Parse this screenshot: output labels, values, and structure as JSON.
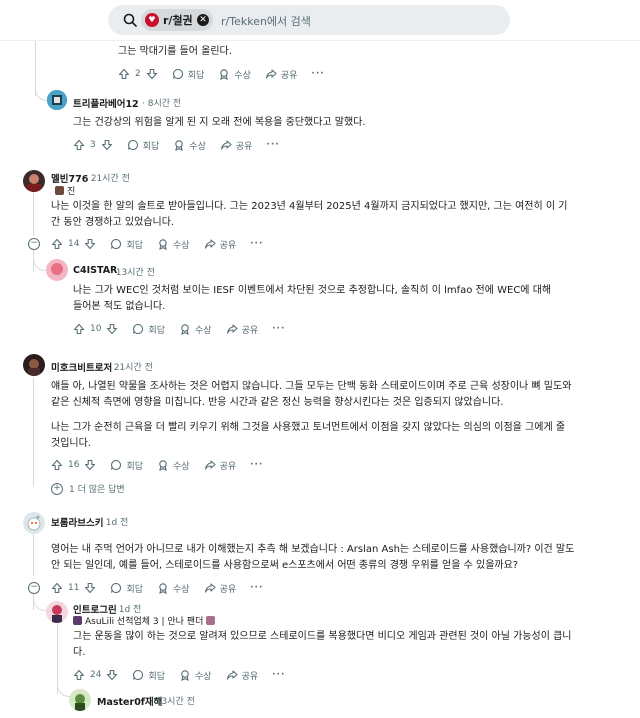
{
  "search": {
    "chip_label": "r/철권",
    "placeholder": "r/Tekken에서 검색"
  },
  "labels": {
    "reply": "회답",
    "award": "수상",
    "share": "공유",
    "more": "···",
    "more_replies": "1 더 많은 답변"
  },
  "comments": [
    {
      "text": "그는 막대기를 들어 올린다.",
      "votes": "2"
    },
    {
      "user": "트리플라베어12",
      "time": "8시간 전",
      "text": "그는 건강상의 위험을 알게 된 지 오래 전에 복용을 중단했다고 말했다.",
      "votes": "3"
    },
    {
      "user": "멜빈776",
      "time": "21시간 전",
      "flair": "진",
      "text": "나는 이것을 한 알의 솔트로 받아들입니다. 그는 2023년 4월부터 2025년 4월까지 금지되었다고 했지만, 그는 여전히 이 기간 동안 경쟁하고 있었습니다.",
      "votes": "14"
    },
    {
      "user": "C4ISTAR",
      "time": "13시간 전",
      "text": "나는 그가 WEC인 것처럼 보이는 IESF 이벤트에서 차단된 것으로 추정합니다, 솔직히 이 lmfao 전에 WEC에 대해 들어본 적도 없습니다.",
      "votes": "10"
    },
    {
      "user": "미호크비트로저",
      "time": "21시간 전",
      "text1": "얘들 아, 나열된 약물을 조사하는 것은 어렵지 않습니다. 그들 모두는 단백 동화 스테로이드이며 주로 근육 성장이나 뼈 밀도와 같은 신체적 측면에 영향을 미칩니다. 반응 시간과 같은 정신 능력을 향상시킨다는 것은 입증되지 않았습니다.",
      "text2": "나는 그가 순전히 근육을 더 빨리 키우기 위해 그것을 사용했고 토너먼트에서 이점을 갖지 않았다는 의심의 이점을 그에게 줄 것입니다.",
      "votes": "16"
    },
    {
      "user": "보롬라브스키",
      "time": "1d 전",
      "text": "영어는 내 주먹 언어가 아니므로 내가 이해했는지 추측 해 보겠습니다 : Arslan Ash는 스테로이드를 사용했습니까? 이건 말도 안 되는 일인데, 예를 들어, 스테로이드를 사용함으로써 e스포츠에서 어떤 종류의 경쟁 우위를 얻을 수 있을까요?",
      "votes": "11"
    },
    {
      "user": "인트로그린",
      "time": "1d 전",
      "flair": "AsuLili 선적업체 3 | 안나 팬더",
      "text": "그는 운동을 많이 하는 것으로 알려져 있으므로 스테로이드를 복용했다면 비디오 게임과 관련된 것이 아닐 가능성이 큽니다.",
      "votes": "24"
    },
    {
      "user": "Master0f재해",
      "time": "23시간 전"
    }
  ],
  "colors": {
    "accent": "#c8102e",
    "muted": "#576f76",
    "thread": "#d7dadc"
  }
}
